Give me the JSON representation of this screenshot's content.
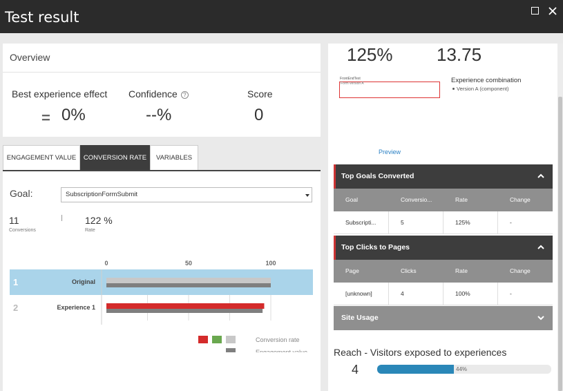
{
  "window": {
    "title": "Test result"
  },
  "overview": {
    "title": "Overview",
    "best_experience_effect_label": "Best experience effect",
    "best_experience_effect_sign": "=",
    "best_experience_effect_value": "0%",
    "confidence_label": "Confidence",
    "confidence_help_glyph": "?",
    "confidence_value": "--%",
    "score_label": "Score",
    "score_value": "0"
  },
  "tabs": [
    {
      "label": "ENGAGEMENT VALUE",
      "active": false
    },
    {
      "label": "CONVERSION RATE",
      "active": true
    },
    {
      "label": "VARIABLES",
      "active": false
    }
  ],
  "goal": {
    "label": "Goal:",
    "selected": "SubscriptionFormSubmit",
    "conversions_value": "11",
    "conversions_caption": "Conversions",
    "rate_value": "122 %",
    "rate_caption": "Rate"
  },
  "chart_data": {
    "type": "bar",
    "orientation": "horizontal",
    "x_ticks": [
      0,
      50,
      100
    ],
    "xlim": [
      0,
      100
    ],
    "grid": true,
    "rows": [
      {
        "index": "1",
        "label": "Original",
        "highlighted": true,
        "conversion_rate": 100,
        "engagement_value": 100
      },
      {
        "index": "2",
        "label": "Experience 1",
        "highlighted": false,
        "conversion_rate": 96,
        "engagement_value": 95
      }
    ],
    "legend": [
      {
        "label": "Conversion rate",
        "colors": [
          "#d42b2b",
          "#6aa84f",
          "#c8c8c8"
        ]
      },
      {
        "label": "Engagement value",
        "colors": [
          "#7f7f7f"
        ]
      }
    ],
    "colors": {
      "conversion_rate_highlighted": "#c8c8c8",
      "conversion_rate_default": "#d42b2b",
      "engagement_value": "#7f7f7f",
      "highlight_row": "#aad4ea"
    }
  },
  "preview": {
    "value_rate": "125%",
    "value_score": "13.75",
    "frontend_title": "FrontEndText",
    "frontend_subtitle": "Form version A",
    "experience_combination_label": "Experience combination",
    "experience_combination_item": "Version A (component)",
    "preview_link": "Preview"
  },
  "top_goals": {
    "title": "Top Goals Converted",
    "columns": [
      "Goal",
      "Conversio...",
      "Rate",
      "Change"
    ],
    "rows": [
      [
        "Subscripti...",
        "5",
        "125%",
        "-"
      ]
    ]
  },
  "top_clicks": {
    "title": "Top Clicks to Pages",
    "columns": [
      "Page",
      "Clicks",
      "Rate",
      "Change"
    ],
    "rows": [
      [
        "[unknown]",
        "4",
        "100%",
        "-"
      ]
    ]
  },
  "site_usage": {
    "title": "Site Usage"
  },
  "reach": {
    "label": "Reach - Visitors exposed to experiences",
    "count": "4",
    "percent": 44,
    "percent_label": "44%"
  },
  "icons": {
    "maximize": "maximize-icon",
    "close": "close-icon",
    "collapse": "chevron-up-icon",
    "expand": "chevron-down-icon",
    "dropdown": "caret-down-icon",
    "help": "help-icon"
  }
}
